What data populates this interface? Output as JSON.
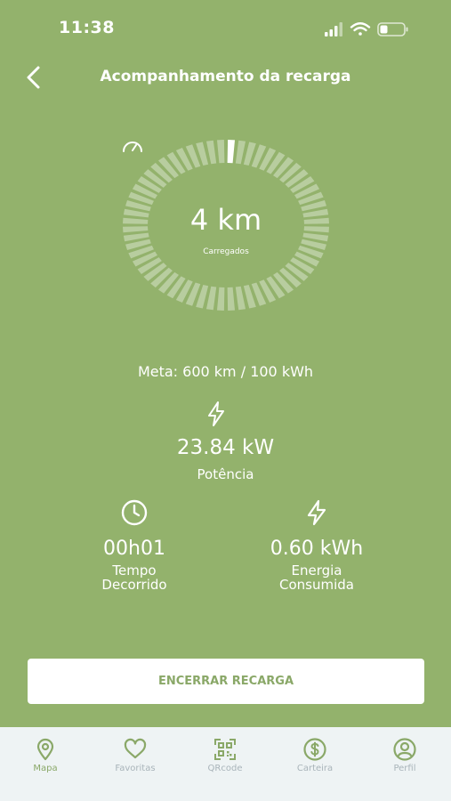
{
  "status_bar": {
    "time": "11:38"
  },
  "header": {
    "title": "Acompanhamento da recarga"
  },
  "gauge": {
    "value_text": "4 km",
    "label": "Carregados",
    "segments_total": 60,
    "segments_filled": 1
  },
  "meta": {
    "text": "Meta: 600 km / 100 kWh"
  },
  "power": {
    "value": "23.84 kW",
    "label": "Potência"
  },
  "stats": [
    {
      "value": "00h01",
      "label_line1": "Tempo",
      "label_line2": "Decorrido",
      "icon": "clock-icon"
    },
    {
      "value": "0.60 kWh",
      "label_line1": "Energia",
      "label_line2": "Consumida",
      "icon": "bolt-icon"
    }
  ],
  "action": {
    "end_label": "ENCERRAR RECARGA"
  },
  "nav": {
    "items": [
      {
        "label": "Mapa",
        "icon": "map-pin-icon",
        "active": true
      },
      {
        "label": "Favoritas",
        "icon": "heart-icon",
        "active": false
      },
      {
        "label": "QRcode",
        "icon": "qrcode-icon",
        "active": false
      },
      {
        "label": "Carteira",
        "icon": "dollar-icon",
        "active": false
      },
      {
        "label": "Perfil",
        "icon": "profile-icon",
        "active": false
      }
    ]
  },
  "colors": {
    "background": "#93b26c",
    "accent": "#8aa868",
    "nav_bg": "#eef3f4",
    "nav_inactive": "#a9b4ba"
  }
}
